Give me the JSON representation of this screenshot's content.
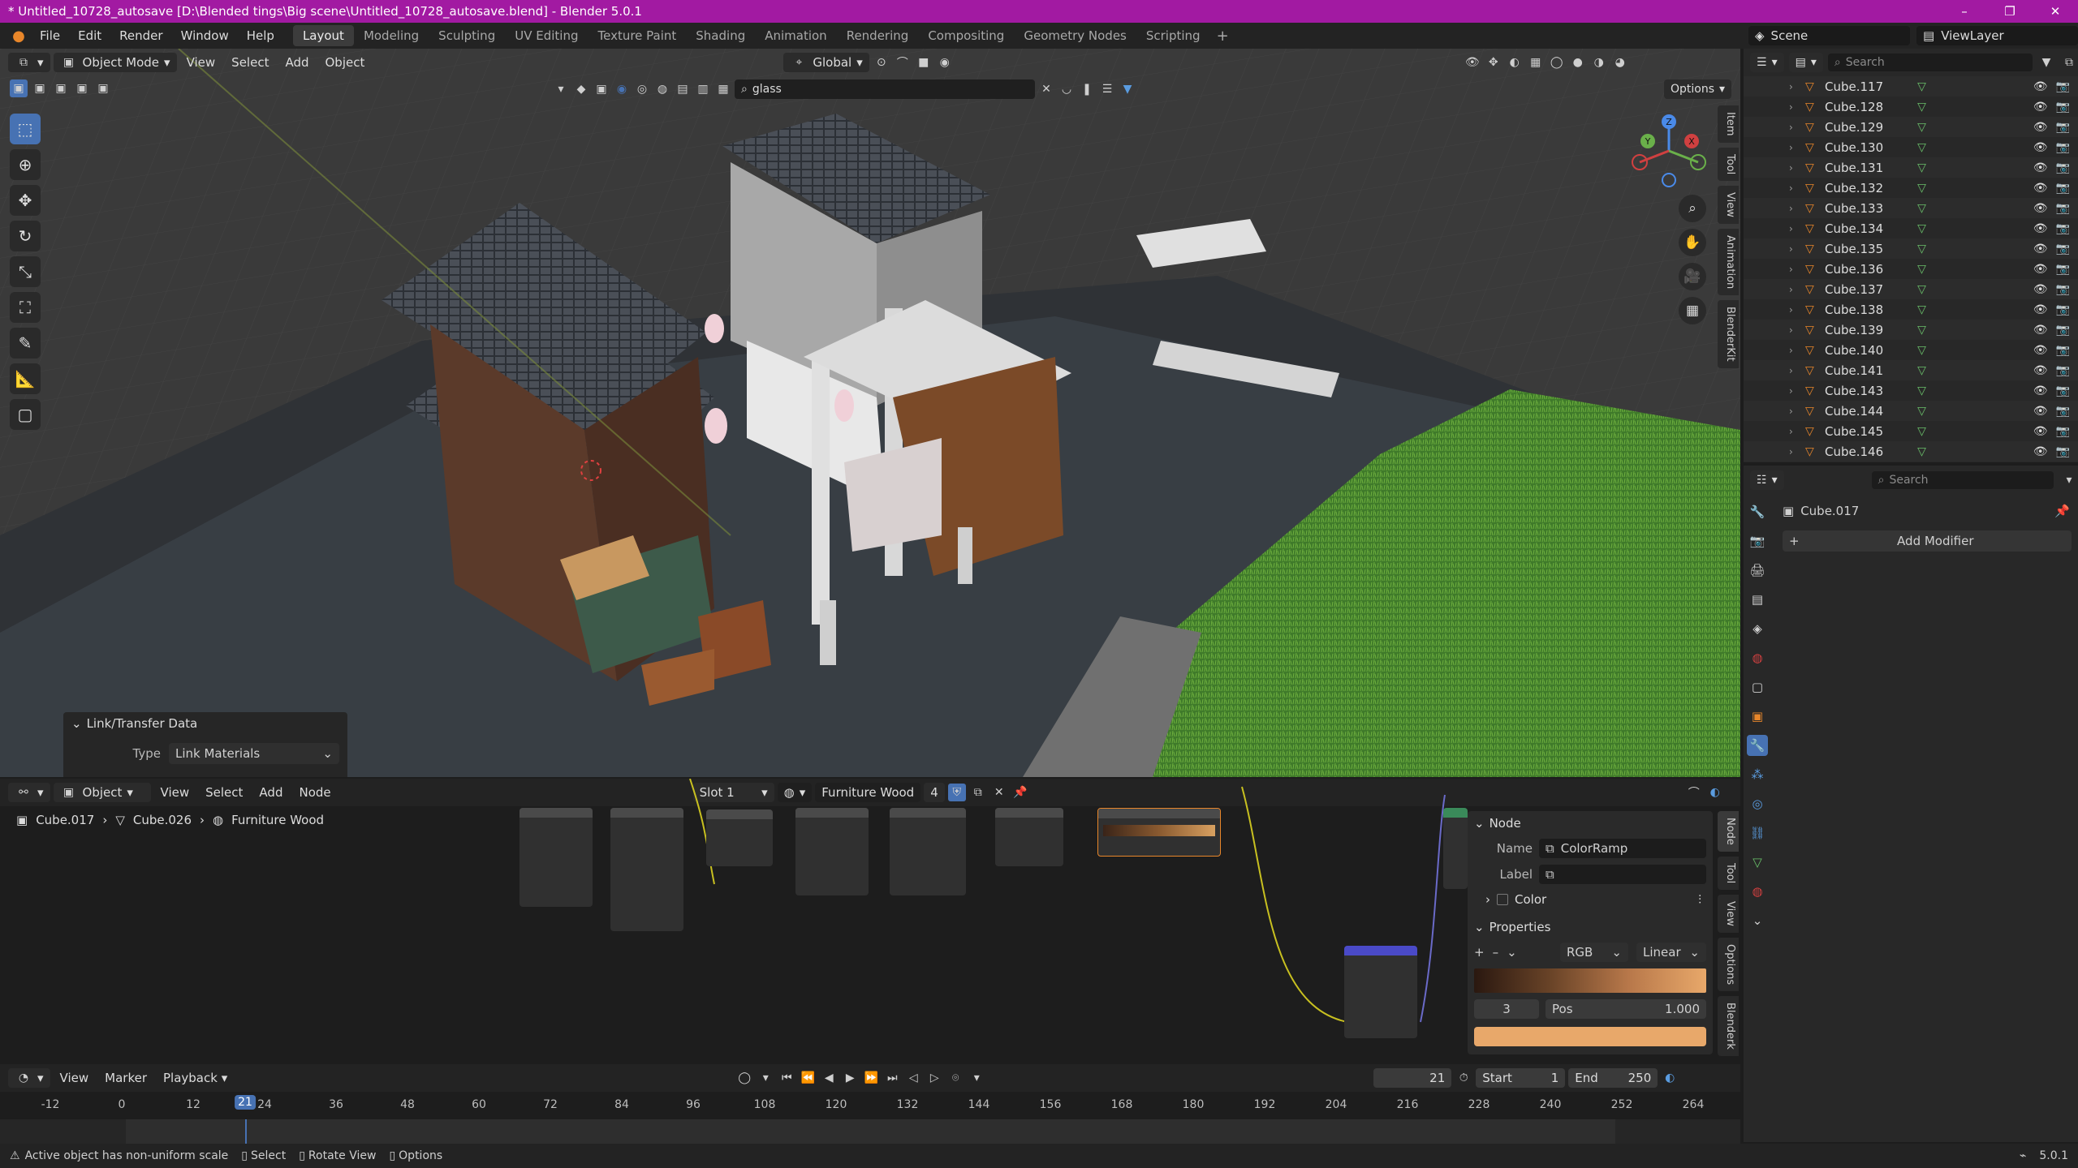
{
  "titlebar": {
    "title": "* Untitled_10728_autosave [D:\\Blended tings\\Big scene\\Untitled_10728_autosave.blend] - Blender 5.0.1",
    "minimize": "–",
    "maximize": "❐",
    "close": "✕"
  },
  "menubar": {
    "menus": [
      "File",
      "Edit",
      "Render",
      "Window",
      "Help"
    ],
    "workspaces": [
      "Layout",
      "Modeling",
      "Sculpting",
      "UV Editing",
      "Texture Paint",
      "Shading",
      "Animation",
      "Rendering",
      "Compositing",
      "Geometry Nodes",
      "Scripting"
    ],
    "active_workspace": "Layout",
    "scene": "Scene",
    "view_layer": "ViewLayer"
  },
  "viewport": {
    "mode": "Object Mode",
    "menus": [
      "View",
      "Select",
      "Add",
      "Object"
    ],
    "orientation": "Global",
    "search_value": "glass",
    "options_label": "Options",
    "sidetabs": [
      "Item",
      "Tool",
      "View",
      "Animation",
      "BlenderKit"
    ],
    "gizmo": {
      "z": "Z",
      "y": "Y",
      "x": "X"
    }
  },
  "operator_panel": {
    "title": "Link/Transfer Data",
    "type_label": "Type",
    "type_value": "Link Materials"
  },
  "node_editor": {
    "type": "Object",
    "menus": [
      "View",
      "Select",
      "Add",
      "Node"
    ],
    "slot": "Slot 1",
    "material": "Furniture Wood",
    "users": "4",
    "breadcrumb": [
      "Cube.017",
      "Cube.026",
      "Furniture Wood"
    ],
    "sidetabs": [
      "Node",
      "Tool",
      "View",
      "Options",
      "Blenderk"
    ],
    "panel": {
      "node_section": "Node",
      "name_label": "Name",
      "name_value": "ColorRamp",
      "label_label": "Label",
      "label_value": "",
      "color_section": "Color",
      "properties_section": "Properties",
      "color_mode": "RGB",
      "interpolation": "Linear",
      "stop_index": "3",
      "pos_label": "Pos",
      "pos_value": "1.000"
    }
  },
  "timeline": {
    "menus": [
      "View",
      "Marker",
      "Playback"
    ],
    "current_frame": "21",
    "start_label": "Start",
    "start": "1",
    "end_label": "End",
    "end": "250",
    "ticks": [
      "-12",
      "0",
      "12",
      "24",
      "36",
      "48",
      "60",
      "72",
      "84",
      "96",
      "108",
      "120",
      "132",
      "144",
      "156",
      "168",
      "180",
      "192",
      "204",
      "216",
      "228",
      "240",
      "252",
      "264"
    ]
  },
  "statusbar": {
    "message": "Active object has non-uniform scale",
    "hints": [
      "Select",
      "Rotate View",
      "Options"
    ],
    "version": "5.0.1"
  },
  "outliner": {
    "search_placeholder": "Search",
    "items": [
      "Cube.117",
      "Cube.128",
      "Cube.129",
      "Cube.130",
      "Cube.131",
      "Cube.132",
      "Cube.133",
      "Cube.134",
      "Cube.135",
      "Cube.136",
      "Cube.137",
      "Cube.138",
      "Cube.139",
      "Cube.140",
      "Cube.141",
      "Cube.143",
      "Cube.144",
      "Cube.145",
      "Cube.146"
    ]
  },
  "properties": {
    "search_placeholder": "Search",
    "object_name": "Cube.017",
    "add_modifier": "Add Modifier"
  },
  "colors": {
    "titlebar": "#a21aa2",
    "accent": "#4772b3",
    "object_orange": "#e8862a",
    "mesh_green": "#6ac06a"
  }
}
